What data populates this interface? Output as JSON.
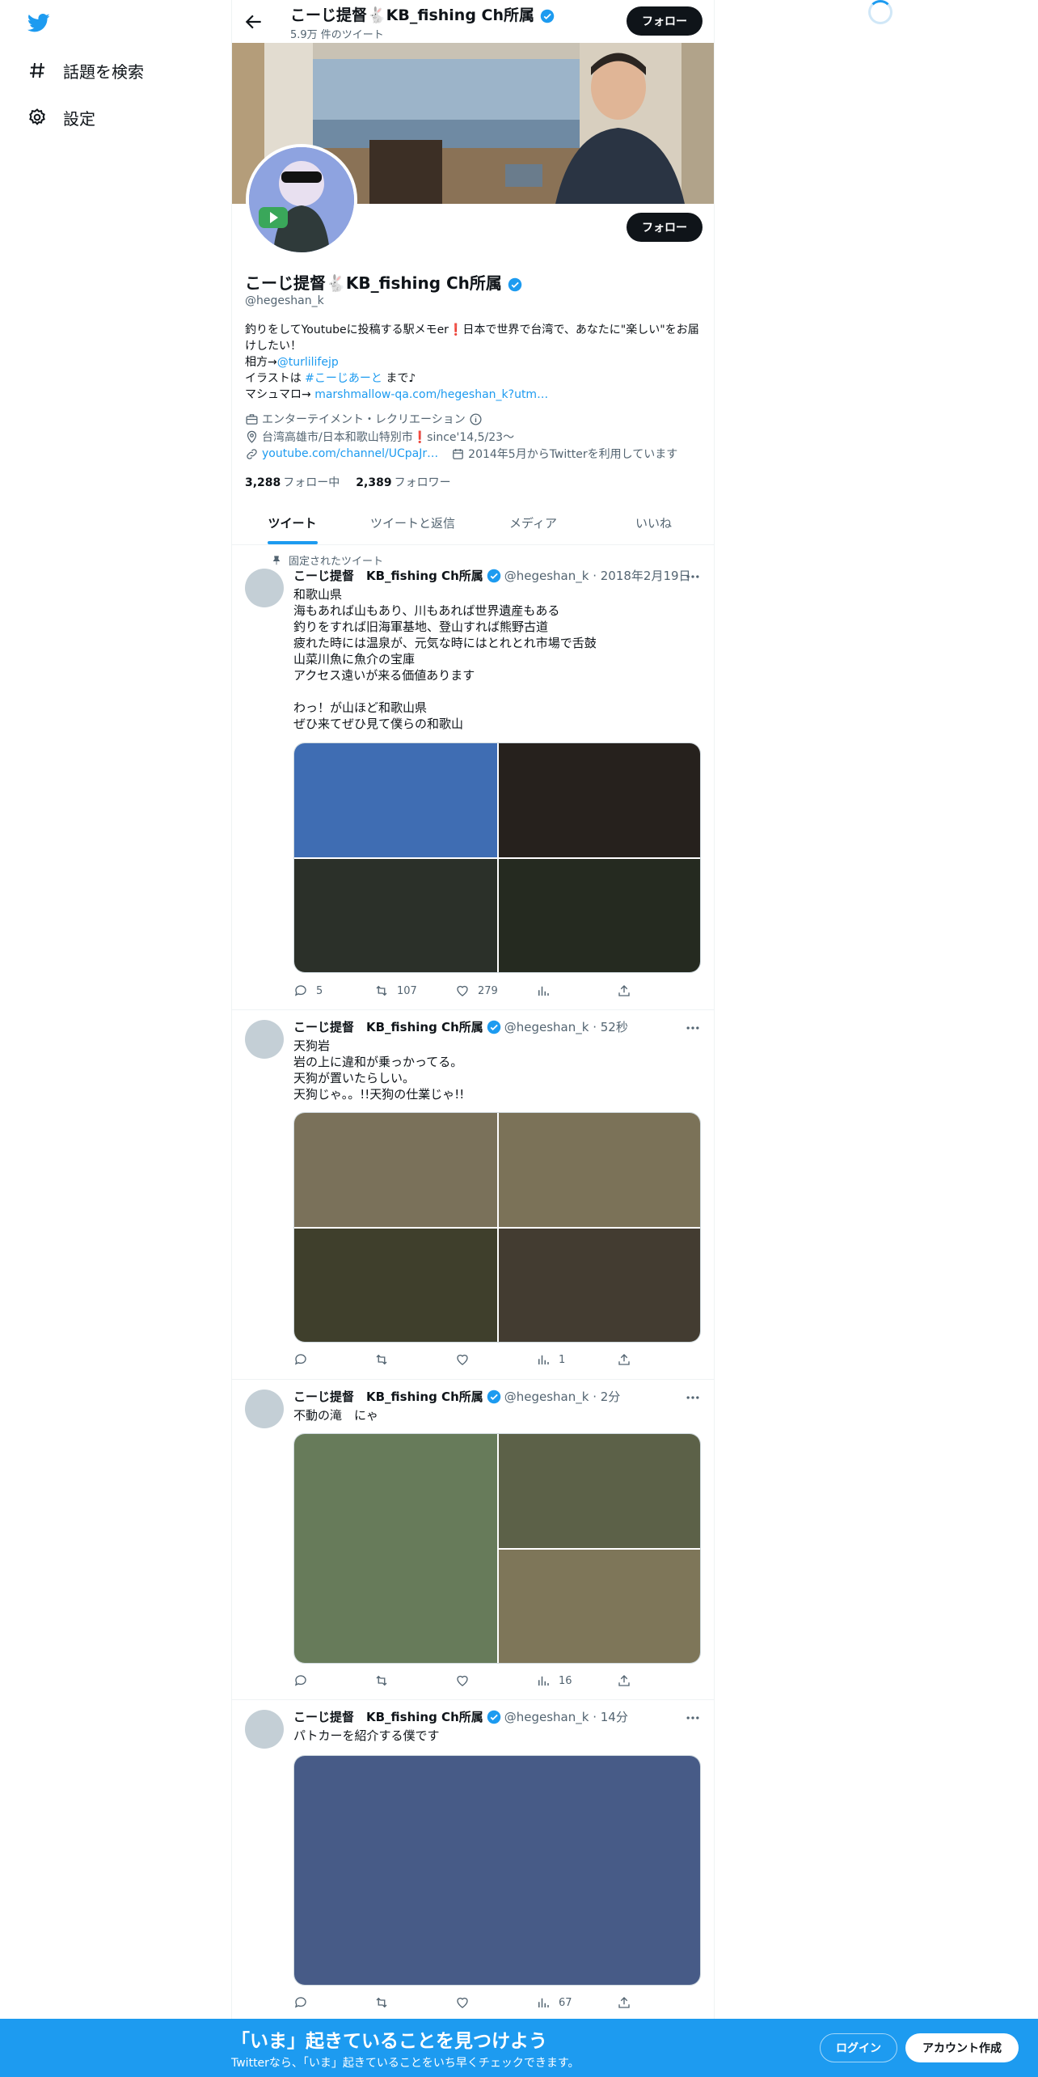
{
  "nav": {
    "explore_label": "話題を検索",
    "settings_label": "設定"
  },
  "header": {
    "name": "こーじ提督🐇KB_fishing Ch所属",
    "tweet_count": "5.9万 件のツイート",
    "follow_label": "フォロー"
  },
  "profile": {
    "name": "こーじ提督🐇KB_fishing Ch所属",
    "handle": "@hegeshan_k",
    "follow_label": "フォロー",
    "bio_line1": "釣りをしてYoutubeに投稿する駅メモer❗日本で世界で台湾で、あなたに\"楽しい\"をお届けしたい！",
    "bio_partner_prefix": "相方→",
    "bio_partner_link": "@turlilifejp",
    "bio_illust_prefix": "イラストは ",
    "bio_illust_tag": "#こーじあーと",
    "bio_illust_suffix": " まで♪",
    "bio_marsh_prefix": "マシュマロ→ ",
    "bio_marsh_link": "marshmallow-qa.com/hegeshan_k?utm…",
    "category": "エンターテイメント・レクリエーション",
    "location": "台湾高雄市/日本和歌山特別市❗since'14,5/23〜",
    "url": "youtube.com/channel/UCpaJr…",
    "joined": "2014年5月からTwitterを利用しています",
    "following_count": "3,288",
    "following_label": "フォロー中",
    "followers_count": "2,389",
    "followers_label": "フォロワー"
  },
  "tabs": [
    "ツイート",
    "ツイートと返信",
    "メディア",
    "いいね"
  ],
  "tweets": [
    {
      "pinned_label": "固定されたツイート",
      "name": "こーじ提督　KB_fishing Ch所属",
      "meta": "@hegeshan_k · 2018年2月19日",
      "text": "和歌山県\n海もあれば山もあり、川もあれば世界遺産もある\n釣りをすれば旧海軍基地、登山すれば熊野古道\n疲れた時には温泉が、元気な時にはとれとれ市場で舌鼓\n山菜川魚に魚介の宝庫\nアクセス遠いが来る価値あります\n\nわっ！が山ほど和歌山県\nぜひ来てぜひ見て僕らの和歌山",
      "media_colors": [
        "#3f6db3",
        "#26211d",
        "#2b3029",
        "#252a20"
      ],
      "replies": "5",
      "retweets": "107",
      "likes": "279",
      "views": ""
    },
    {
      "name": "こーじ提督　KB_fishing Ch所属",
      "meta": "@hegeshan_k · 52秒",
      "text": "天狗岩\n岩の上に違和が乗っかってる。\n天狗が置いたらしい。\n天狗じゃ。。!!天狗の仕業じゃ!!",
      "media_colors": [
        "#7a715a",
        "#7b7258",
        "#3f3f2c",
        "#433c31"
      ],
      "replies": "",
      "retweets": "",
      "likes": "",
      "views": "1"
    },
    {
      "name": "こーじ提督　KB_fishing Ch所属",
      "meta": "@hegeshan_k · 2分",
      "text": "不動の滝　にゃ",
      "media_colors": [
        "#677b5a",
        "#5c6148",
        "#7e7659"
      ],
      "replies": "",
      "retweets": "",
      "likes": "",
      "views": "16"
    },
    {
      "name": "こーじ提督　KB_fishing Ch所属",
      "meta": "@hegeshan_k · 14分",
      "text": "パトカーを紹介する僕です",
      "media_colors": [
        "#475b87"
      ],
      "replies": "",
      "retweets": "",
      "likes": "",
      "views": "67"
    }
  ],
  "bottom": {
    "title": "「いま」起きていることを見つけよう",
    "subtitle": "Twitterなら、「いま」起きていることをいち早くチェックできます。",
    "login_label": "ログイン",
    "signup_label": "アカウント作成"
  },
  "colors": {
    "accent": "#1d9bf0",
    "dark": "#0f1419",
    "muted": "#536471"
  }
}
